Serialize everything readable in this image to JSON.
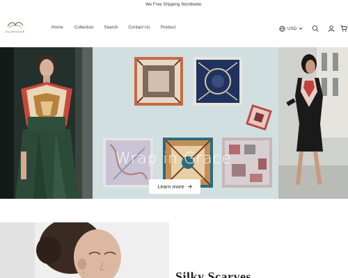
{
  "announcement": {
    "text": "We Free Shipping Worldwide."
  },
  "brand": {
    "wordmark": "ELOWYNNE"
  },
  "nav": {
    "items": [
      {
        "label": "Home"
      },
      {
        "label": "Collection"
      },
      {
        "label": "Search"
      },
      {
        "label": "Contact Us"
      },
      {
        "label": "Product"
      }
    ]
  },
  "header_actions": {
    "currency": "USD",
    "icons": [
      "globe-icon",
      "chevron-down-icon",
      "search-icon",
      "user-icon",
      "cart-icon"
    ]
  },
  "hero": {
    "title": "Wrap in Grace",
    "cta_label": "Learn more",
    "cta_icon": "arrow-right-icon",
    "slide_count": 2,
    "active_slide": 1
  },
  "featured": {
    "title": "Silky Scarves"
  },
  "colors": {
    "hero_bg": "#d1dfe0",
    "text": "#1e1e1e",
    "background": "#ffffff"
  }
}
